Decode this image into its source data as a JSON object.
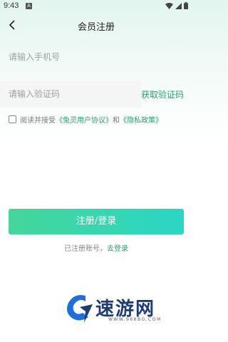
{
  "status_bar": {
    "time": "9:43",
    "app_icon": "A"
  },
  "nav": {
    "title": "会员注册"
  },
  "phone": {
    "placeholder": "请输入手机号"
  },
  "code": {
    "placeholder": "请输入验证码",
    "get_code_label": "获取验证码"
  },
  "agreement": {
    "prefix": "阅读并接受",
    "user_agreement": "《兔灵用户协议》",
    "and": "和",
    "privacy_policy": "《隐私政策》"
  },
  "register_button": "注册/登录",
  "login_prompt": {
    "text": "已注册账号，",
    "link": "去登录"
  },
  "watermark": {
    "brand": "速游网",
    "domain": "WWW.966BG.COM"
  },
  "colors": {
    "accent": "#2a9d70",
    "button_start": "#45d69a",
    "button_end": "#2bd6c4"
  }
}
